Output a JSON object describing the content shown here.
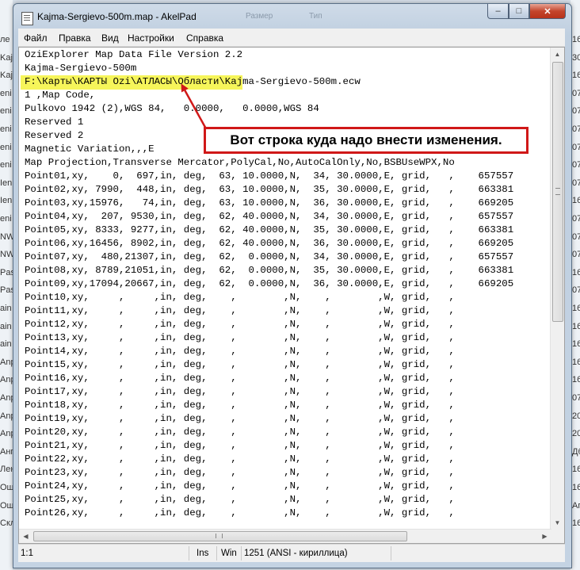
{
  "window": {
    "title": "Kajma-Sergievo-500m.map - AkelPad",
    "ghost_labels": [
      "Размер",
      "Тип"
    ],
    "buttons": {
      "minimize": "–",
      "maximize": "□",
      "close": "✕"
    }
  },
  "background_left": [
    "ле",
    "Kaj",
    "Kaj",
    "eni",
    "eni",
    "eni",
    "eni",
    "eni",
    "Ien",
    "Ien",
    "eni",
    "NW",
    "NW",
    "Pas",
    "Pas",
    "ain",
    "ain",
    "ain",
    "Anp",
    "Anp",
    "Anp",
    "Anp",
    "Anp",
    "Анг",
    "Лен",
    "Ош",
    "Ош",
    "Скл"
  ],
  "background_right": [
    "16",
    "30",
    "16",
    "07",
    "07",
    "07",
    "07",
    "07",
    "07",
    "16",
    "07",
    "07",
    "07",
    "16",
    "07",
    "16",
    "16",
    "16",
    "16",
    "16",
    "07",
    "20",
    "20",
    "Дб",
    "16",
    "16",
    "Ап",
    "16"
  ],
  "menu": [
    "Файл",
    "Правка",
    "Вид",
    "Настройки",
    "Справка"
  ],
  "editor": {
    "lines": [
      "OziExplorer Map Data File Version 2.2",
      "Kajma-Sergievo-500m",
      "F:\\Карты\\КАРТЫ Ozi\\АТЛАСЫ\\Области\\Kajma-Sergievo-500m.ecw",
      "1 ,Map Code,",
      "Pulkovo 1942 (2),WGS 84,   0.0000,   0.0000,WGS 84",
      "Reserved 1",
      "Reserved 2",
      "Magnetic Variation,,,E",
      "Map Projection,Transverse Mercator,PolyCal,No,AutoCalOnly,No,BSBUseWPX,No",
      "Point01,xy,    0,  697,in, deg,  63, 10.0000,N,  34, 30.0000,E, grid,   ,    657557",
      "Point02,xy, 7990,  448,in, deg,  63, 10.0000,N,  35, 30.0000,E, grid,   ,    663381",
      "Point03,xy,15976,   74,in, deg,  63, 10.0000,N,  36, 30.0000,E, grid,   ,    669205",
      "Point04,xy,  207, 9530,in, deg,  62, 40.0000,N,  34, 30.0000,E, grid,   ,    657557",
      "Point05,xy, 8333, 9277,in, deg,  62, 40.0000,N,  35, 30.0000,E, grid,   ,    663381",
      "Point06,xy,16456, 8902,in, deg,  62, 40.0000,N,  36, 30.0000,E, grid,   ,    669205",
      "Point07,xy,  480,21307,in, deg,  62,  0.0000,N,  34, 30.0000,E, grid,   ,    657557",
      "Point08,xy, 8789,21051,in, deg,  62,  0.0000,N,  35, 30.0000,E, grid,   ,    663381",
      "Point09,xy,17094,20667,in, deg,  62,  0.0000,N,  36, 30.0000,E, grid,   ,    669205",
      "Point10,xy,     ,     ,in, deg,    ,        ,N,    ,        ,W, grid,   ,",
      "Point11,xy,     ,     ,in, deg,    ,        ,N,    ,        ,W, grid,   ,",
      "Point12,xy,     ,     ,in, deg,    ,        ,N,    ,        ,W, grid,   ,",
      "Point13,xy,     ,     ,in, deg,    ,        ,N,    ,        ,W, grid,   ,",
      "Point14,xy,     ,     ,in, deg,    ,        ,N,    ,        ,W, grid,   ,",
      "Point15,xy,     ,     ,in, deg,    ,        ,N,    ,        ,W, grid,   ,",
      "Point16,xy,     ,     ,in, deg,    ,        ,N,    ,        ,W, grid,   ,",
      "Point17,xy,     ,     ,in, deg,    ,        ,N,    ,        ,W, grid,   ,",
      "Point18,xy,     ,     ,in, deg,    ,        ,N,    ,        ,W, grid,   ,",
      "Point19,xy,     ,     ,in, deg,    ,        ,N,    ,        ,W, grid,   ,",
      "Point20,xy,     ,     ,in, deg,    ,        ,N,    ,        ,W, grid,   ,",
      "Point21,xy,     ,     ,in, deg,    ,        ,N,    ,        ,W, grid,   ,",
      "Point22,xy,     ,     ,in, deg,    ,        ,N,    ,        ,W, grid,   ,",
      "Point23,xy,     ,     ,in, deg,    ,        ,N,    ,        ,W, grid,   ,",
      "Point24,xy,     ,     ,in, deg,    ,        ,N,    ,        ,W, grid,   ,",
      "Point25,xy,     ,     ,in, deg,    ,        ,N,    ,        ,W, grid,   ,",
      "Point26,xy,     ,     ,in, deg,    ,        ,N,    ,        ,W, grid,   ,"
    ],
    "highlight_color": "#f6f55a"
  },
  "status": {
    "position": "1:1",
    "insert_mode": "Ins",
    "newline": "Win",
    "codepage": "1251  (ANSI - кириллица)"
  },
  "annotation": {
    "text": "Вот строка куда надо внести изменения.",
    "color": "#d01818"
  }
}
